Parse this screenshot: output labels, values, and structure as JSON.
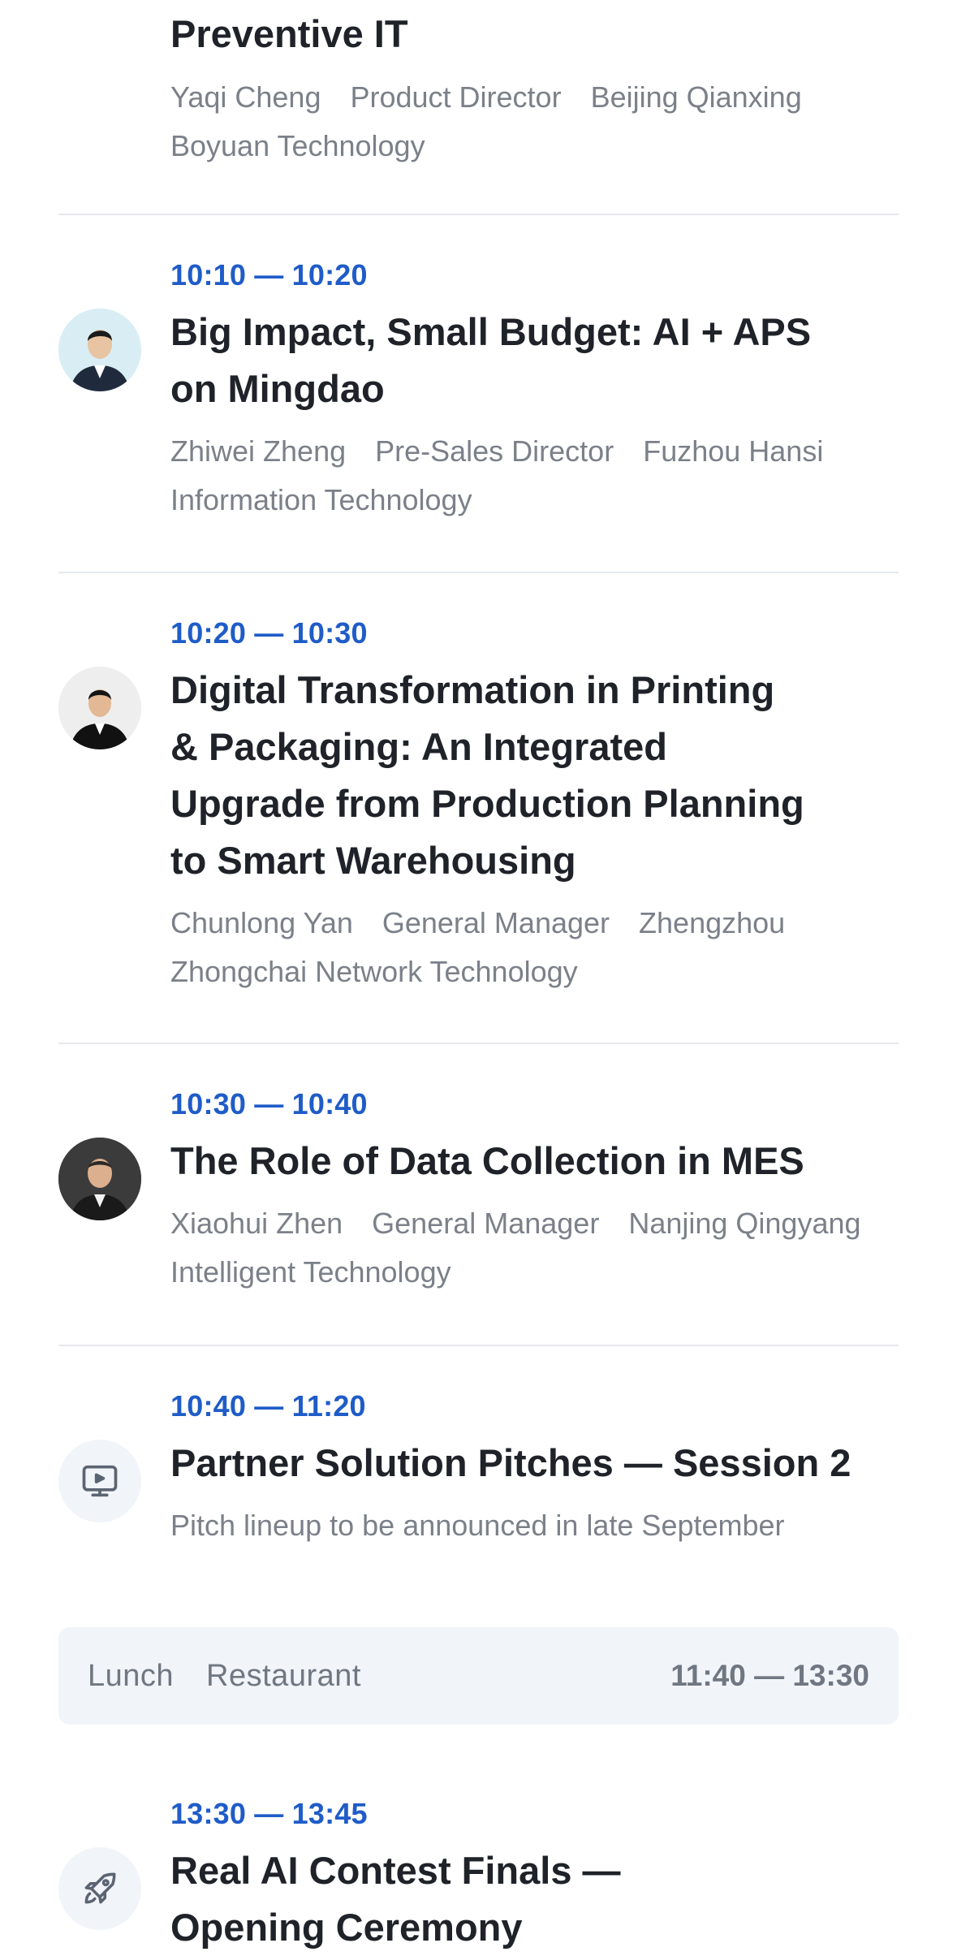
{
  "sessions": [
    {
      "title": "Preventive IT",
      "speaker": "Yaqi Cheng",
      "role": "Product Director",
      "company": "Beijing Qianxing Boyuan Technology"
    },
    {
      "time": "10:10 — 10:20",
      "title": "Big Impact, Small Budget: AI + APS on Mingdao",
      "speaker": "Zhiwei Zheng",
      "role": "Pre-Sales Director",
      "company": "Fuzhou Hansi Information Technology"
    },
    {
      "time": "10:20 — 10:30",
      "title": "Digital Transformation in Printing & Packaging: An Integrated Upgrade from Production Planning to Smart Warehousing",
      "speaker": "Chunlong Yan",
      "role": "General Manager",
      "company": "Zhengzhou Zhongchai Network Technology"
    },
    {
      "time": "10:30 — 10:40",
      "title": "The Role of Data Collection in MES",
      "speaker": "Xiaohui Zhen",
      "role": "General Manager",
      "company": "Nanjing Qingyang Intelligent Technology"
    },
    {
      "time": "10:40 — 11:20",
      "title": "Partner Solution Pitches — Session 2",
      "note": "Pitch lineup to be announced in late September",
      "icon": "presentation-screen-icon"
    },
    {
      "time": "13:30 — 13:45",
      "title": "Real AI Contest Finals — Opening Ceremony",
      "icon": "rocket-icon"
    }
  ],
  "lunch": {
    "label": "Lunch",
    "location": "Restaurant",
    "time": "11:40 — 13:30"
  },
  "colors": {
    "accent": "#1f5cc8",
    "text": "#1f2329",
    "muted": "#7b8089",
    "divider": "#e6e8ec",
    "panel": "#f1f4f8"
  }
}
